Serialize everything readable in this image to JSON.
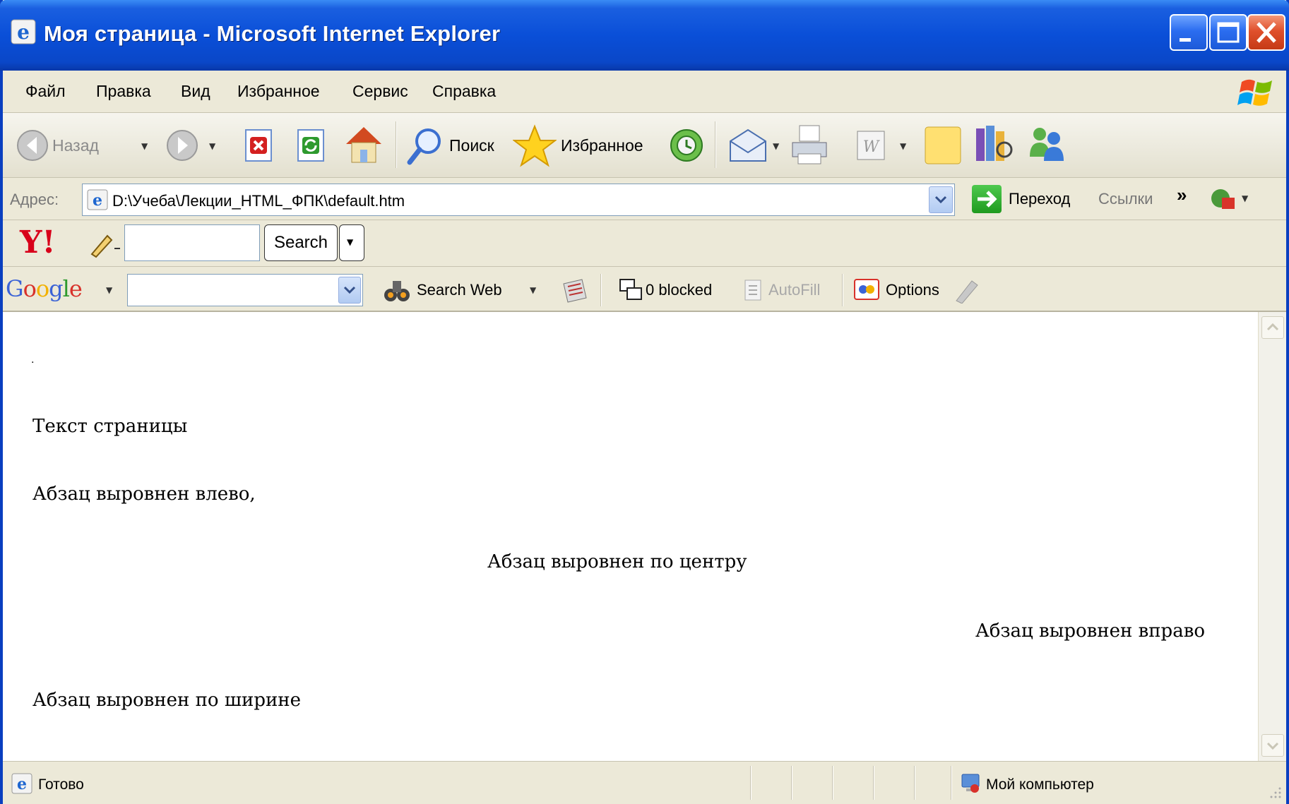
{
  "window": {
    "title": "Моя страница - Microsoft Internet Explorer"
  },
  "menu": {
    "items": [
      "Файл",
      "Правка",
      "Вид",
      "Избранное",
      "Сервис",
      "Справка"
    ]
  },
  "toolbar": {
    "back_label": "Назад",
    "search_label": "Поиск",
    "favorites_label": "Избранное"
  },
  "address": {
    "label": "Адрес:",
    "url": "D:\\Учеба\\Лекции_HTML_ФПК\\default.htm",
    "go_label": "Переход",
    "links_label": "Ссылки",
    "links_chevron": "»"
  },
  "yahoo": {
    "logo": "Y!",
    "search_value": "",
    "search_button": "Search"
  },
  "google": {
    "logo": "Google",
    "search_value": "",
    "search_web_label": "Search Web",
    "blocked_label": "0 blocked",
    "autofill_label": "AutoFill",
    "options_label": "Options"
  },
  "content": {
    "dot": ".",
    "page_text": "Текст страницы",
    "left_paragraph": "Абзац выровнен влево,",
    "center_paragraph": "Абзац выровнен по центру",
    "right_paragraph": "Абзац выровнен вправо",
    "justify_paragraph": "Абзац выровнен по ширине"
  },
  "status": {
    "text": "Готово",
    "zone": "Мой компьютер"
  }
}
